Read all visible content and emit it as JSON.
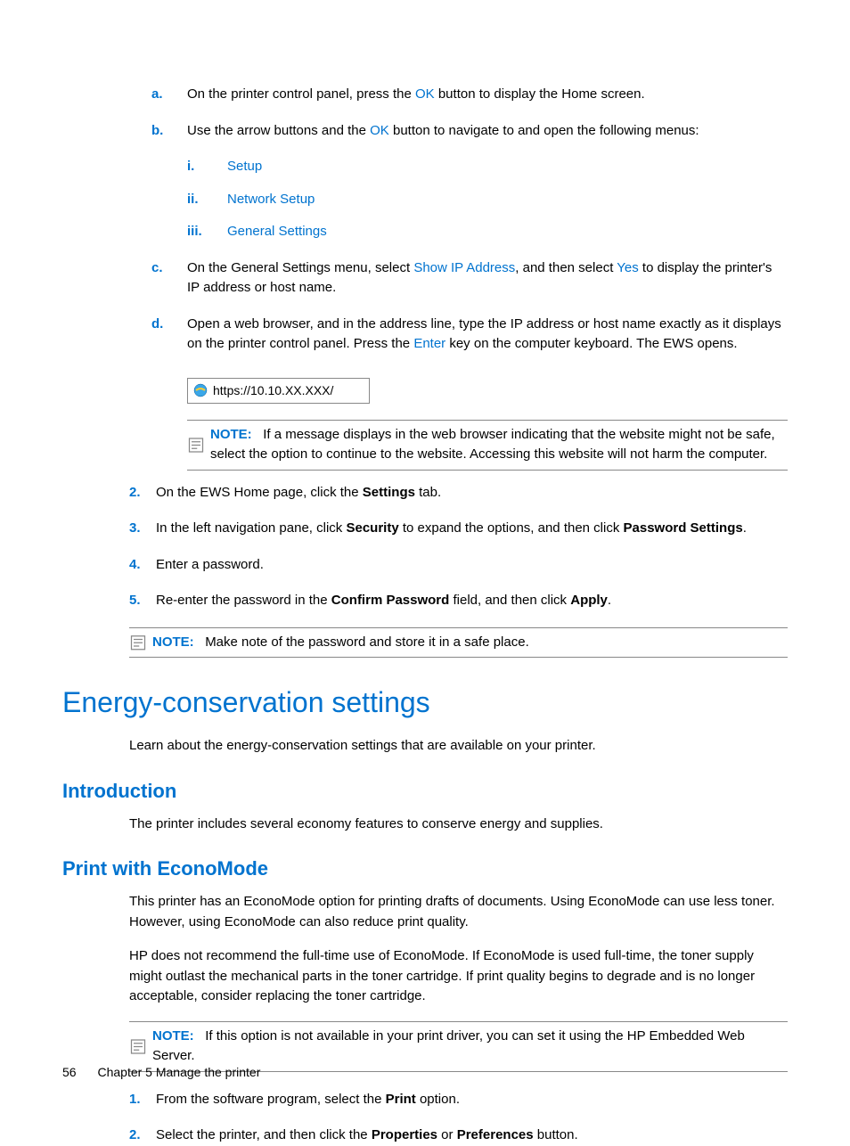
{
  "steps_a": {
    "marker": "a.",
    "prefix": "On the printer control panel, press the ",
    "ok": "OK",
    "suffix": " button to display the Home screen."
  },
  "steps_b": {
    "marker": "b.",
    "prefix": "Use the arrow buttons and the ",
    "ok": "OK",
    "suffix": " button to navigate to and open the following menus:"
  },
  "roman": {
    "i_marker": "i.",
    "i_text": "Setup",
    "ii_marker": "ii.",
    "ii_text": "Network Setup",
    "iii_marker": "iii.",
    "iii_text": "General Settings"
  },
  "steps_c": {
    "marker": "c.",
    "t1": "On the General Settings menu, select ",
    "link1": "Show IP Address",
    "t2": ", and then select ",
    "link2": "Yes",
    "t3": " to display the printer's IP address or host name."
  },
  "steps_d": {
    "marker": "d.",
    "t1": "Open a web browser, and in the address line, type the IP address or host name exactly as it displays on the printer control panel. Press the ",
    "link1": "Enter",
    "t2": " key on the computer keyboard. The EWS opens."
  },
  "url": "https://10.10.XX.XXX/",
  "note1": {
    "label": "NOTE:",
    "text": "If a message displays in the web browser indicating that the website might not be safe, select the option to continue to the website. Accessing this website will not harm the computer."
  },
  "num2": {
    "marker": "2.",
    "t1": "On the EWS Home page, click the ",
    "b1": "Settings",
    "t2": " tab."
  },
  "num3": {
    "marker": "3.",
    "t1": "In the left navigation pane, click ",
    "b1": "Security",
    "t2": " to expand the options, and then click ",
    "b2": "Password Settings",
    "t3": "."
  },
  "num4": {
    "marker": "4.",
    "t1": "Enter a password."
  },
  "num5": {
    "marker": "5.",
    "t1": "Re-enter the password in the ",
    "b1": "Confirm Password",
    "t2": " field, and then click ",
    "b2": "Apply",
    "t3": "."
  },
  "note2": {
    "label": "NOTE:",
    "text": "Make note of the password and store it in a safe place."
  },
  "h1": "Energy-conservation settings",
  "h1_sub": "Learn about the energy-conservation settings that are available on your printer.",
  "h2_intro": "Introduction",
  "intro_text": "The printer includes several economy features to conserve energy and supplies.",
  "h2_econo": "Print with EconoMode",
  "econo_p1": "This printer has an EconoMode option for printing drafts of documents. Using EconoMode can use less toner. However, using EconoMode can also reduce print quality.",
  "econo_p2": "HP does not recommend the full-time use of EconoMode. If EconoMode is used full-time, the toner supply might outlast the mechanical parts in the toner cartridge. If print quality begins to degrade and is no longer acceptable, consider replacing the toner cartridge.",
  "note3": {
    "label": "NOTE:",
    "text": "If this option is not available in your print driver, you can set it using the HP Embedded Web Server."
  },
  "econo_s1": {
    "marker": "1.",
    "t1": "From the software program, select the ",
    "b1": "Print",
    "t2": " option."
  },
  "econo_s2": {
    "marker": "2.",
    "t1": "Select the printer, and then click the ",
    "b1": "Properties",
    "t2": " or ",
    "b2": "Preferences",
    "t3": " button."
  },
  "footer": {
    "page": "56",
    "chapter": "Chapter 5  Manage the printer"
  }
}
